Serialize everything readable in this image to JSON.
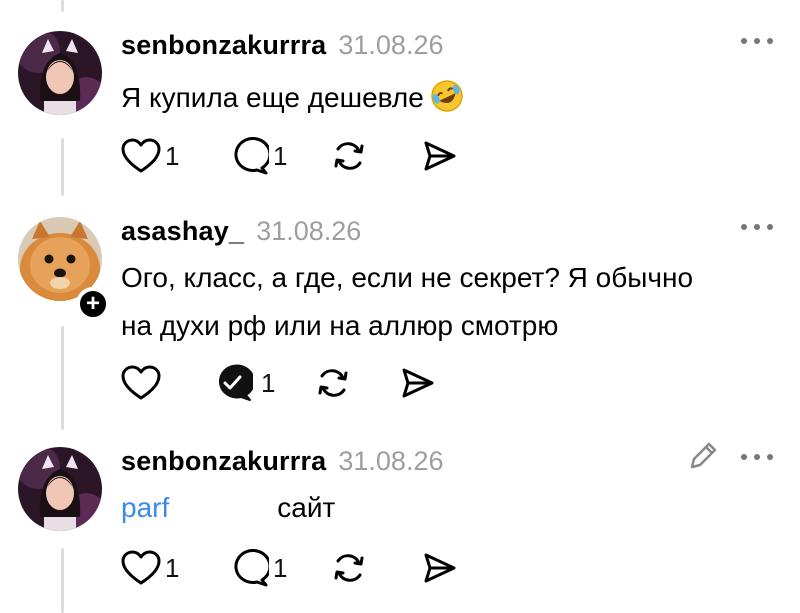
{
  "posts": [
    {
      "username": "senbonzakurrra",
      "date": "31.08.26",
      "text": "Я купила еще дешевле",
      "emoji_name": "rolling-on-floor-laughing-emoji",
      "likes": "1",
      "replies": "1"
    },
    {
      "username": "asashay_",
      "date": "31.08.26",
      "text_line1": "Ого, класс, а где, если не секрет? Я обычно",
      "text_line2": "на духи рф или на аллюр смотрю",
      "follow_symbol": "+",
      "likes": "",
      "replies": "1"
    },
    {
      "username": "senbonzakurrra",
      "date": "31.08.26",
      "link_text": "parf",
      "text_after": "сайт",
      "likes": "1",
      "replies": "1"
    }
  ],
  "icons": {
    "like": "heart-icon",
    "reply": "comment-icon",
    "replied": "comment-check-icon",
    "repost": "repost-icon",
    "share": "send-icon",
    "more": "more-dots-icon",
    "edit": "pencil-icon"
  },
  "colors": {
    "link": "#3b8be6",
    "date": "#9e9e9e",
    "thread_line": "#dcdcdc"
  }
}
